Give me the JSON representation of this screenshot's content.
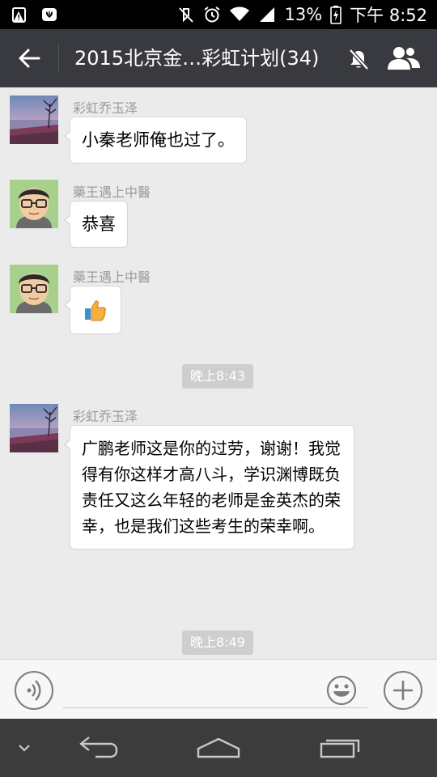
{
  "status_bar": {
    "battery": "13%",
    "time": "下午 8:52",
    "icons": [
      "warning-icon",
      "huawei-icon",
      "mute-vibrate-icon",
      "alarm-icon",
      "wifi-icon",
      "signal-icon",
      "battery-charging-icon"
    ]
  },
  "header": {
    "title": "2015北京金…彩虹计划(34)",
    "icons": [
      "back-arrow-icon",
      "mute-notifications-icon",
      "group-members-icon"
    ]
  },
  "messages": [
    {
      "sender": "彩虹乔玉泽",
      "avatar": "lake-sunset-avatar",
      "text": "小秦老师俺也过了。"
    },
    {
      "sender": "藥王遇上中醫",
      "avatar": "cartoon-man-avatar",
      "text": "恭喜"
    },
    {
      "sender": "藥王遇上中醫",
      "avatar": "cartoon-man-avatar",
      "emoji": "thumbs-up-icon"
    },
    {
      "time": "晚上8:43"
    },
    {
      "sender": "彩虹乔玉泽",
      "avatar": "lake-sunset-avatar",
      "text": "广鹏老师这是你的过劳，谢谢！我觉得有你这样才高八斗，学识渊博既负责任又这么年轻的老师是金英杰的荣幸，也是我们这些考生的荣幸啊。"
    },
    {
      "time": "晚上8:49"
    }
  ],
  "input_bar": {
    "value": "",
    "icons": [
      "voice-icon",
      "emoji-icon",
      "add-icon"
    ]
  },
  "nav_bar": {
    "icons": [
      "hide-keyboard-icon",
      "back-icon",
      "home-icon",
      "recent-apps-icon"
    ]
  },
  "colors": {
    "title_bar": "#393a3f",
    "chat_background": "#ebebeb",
    "bubble": "#ffffff",
    "time_chip": "#cecece",
    "nav_bar": "#3c3c3c"
  }
}
